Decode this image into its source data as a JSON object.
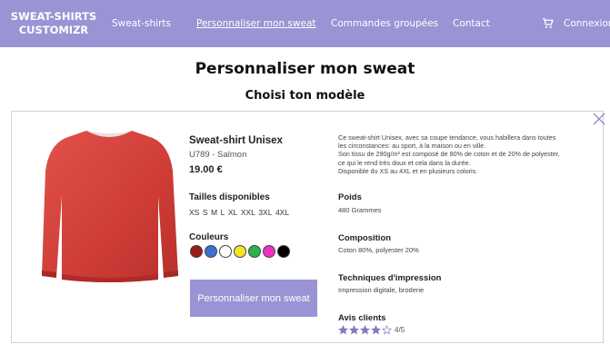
{
  "nav": {
    "brand_line1": "SWEAT-SHIRTS",
    "brand_line2": "CUSTOMIZR",
    "links": [
      "Sweat-shirts",
      "Personnaliser mon sweat",
      "Commandes groupées",
      "Contact"
    ],
    "login": "Connexion",
    "cart_icon": "cart-icon",
    "accent": "#9a93d4"
  },
  "page": {
    "title": "Personnaliser mon sweat",
    "section_title": "Choisi ton modèle"
  },
  "product": {
    "name": "Sweat-shirt Unisex",
    "ref": "U789 - Salmon",
    "price": "19.00 €",
    "sizes_label": "Tailles disponibles",
    "sizes": [
      "XS",
      "S",
      "M",
      "L",
      "XL",
      "XXL",
      "3XL",
      "4XL"
    ],
    "colors_label": "Couleurs",
    "colors": [
      "#9b1c1c",
      "#3b6fd1",
      "#ffffff",
      "#f5e52a",
      "#2db24a",
      "#f02fc2",
      "#000000"
    ],
    "button": "Personnaliser mon sweat",
    "description": [
      "Ce sweat-shirt Unisex, avec sa coupe tendance, vous habillera dans toutes",
      "les circonstances: au sport, à la maison ou en ville.",
      "Son tissu de 290g/m² est composé de 80% de coton et de 20% de polyester,",
      "ce qui le rend très doux et cela dans la durée.",
      "Disponible du XS au 4XL et en plusieurs coloris."
    ],
    "weight_label": "Poids",
    "weight": "480 Grammes",
    "composition_label": "Composition",
    "composition": "Coton 80%, polyester 20%",
    "printing_label": "Techniques d'impression",
    "printing": "Impression digitale, broderie",
    "reviews_label": "Avis clients",
    "rating": 4,
    "rating_max": 5,
    "rating_text": "4/5",
    "sweat_color": "#d6453f"
  }
}
